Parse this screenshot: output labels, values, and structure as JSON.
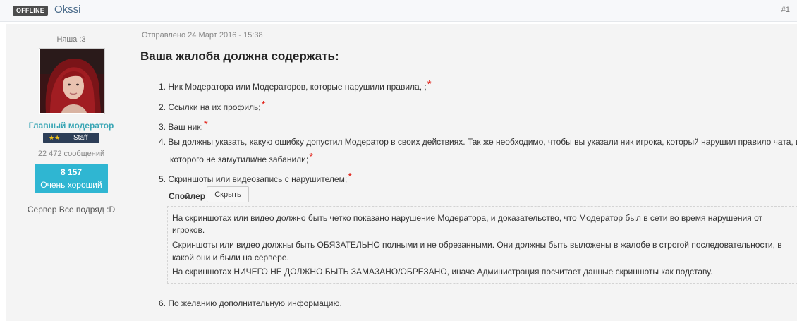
{
  "header": {
    "status_badge": "OFFLINE",
    "username": "Okssi",
    "post_number": "#1"
  },
  "sidebar": {
    "user_title": "Няша :3",
    "group_name": "Главный модератор",
    "badge_stars": "★★",
    "badge_label": "Staff",
    "messages": "22 472 сообщений",
    "reputation_value": "8 157",
    "reputation_label": "Очень хороший",
    "server": "Сервер Все подряд :D"
  },
  "post": {
    "date": "Отправлено 24 Март 2016 - 15:38",
    "heading": "Ваша жалоба должна содержать:",
    "required_mark": "*",
    "items": [
      "Ник Модератора или Модераторов, которые нарушили правила, ;",
      "Ссылки на их профиль;",
      "Ваш ник;",
      "Вы должны указать, какую ошибку допустил Модератор в своих действиях. Так же необходимо, чтобы вы указали ник игрока, который нарушил правило чата, и",
      "которого не замутили/не забанили;",
      "Скриншоты или видеозапись с нарушителем;",
      "По желанию дополнительную информацию."
    ],
    "spoiler": {
      "label": "Спойлер",
      "button": "Скрыть",
      "lines": [
        "На скриншотах или видео должно быть четко показано нарушение Модератора, и доказательство, что Модератор был в сети во время нарушения от",
        "игроков.",
        "Скриншоты или видео должны быть ОБЯЗАТЕЛЬНО полными и не обрезанными. Они должны быть выложены в жалобе в строгой последовательности, в",
        "какой они и были на сервере.",
        "На скриншотах НИЧЕГО НЕ ДОЛЖНО БЫТЬ ЗАМАЗАНО/ОБРЕЗАНО, иначе Администрация посчитает данные скриншоты как подставу."
      ]
    }
  },
  "colors": {
    "accent": "#3aa6b5",
    "reputation": "#2fb6d2",
    "required": "#e2231a",
    "badge": "#2d3e57"
  }
}
